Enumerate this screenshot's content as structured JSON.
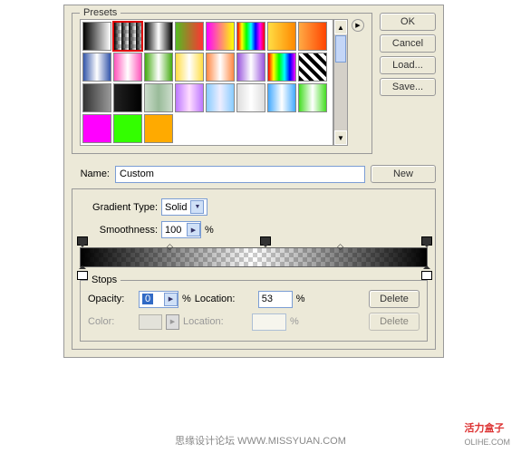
{
  "presets": {
    "label": "Presets"
  },
  "buttons": {
    "ok": "OK",
    "cancel": "Cancel",
    "load": "Load...",
    "save": "Save...",
    "new": "New",
    "delete": "Delete"
  },
  "name": {
    "label": "Name:",
    "value": "Custom"
  },
  "gradient_type": {
    "label": "Gradient Type:",
    "value": "Solid"
  },
  "smoothness": {
    "label": "Smoothness:",
    "value": "100",
    "unit": "%"
  },
  "stops": {
    "label": "Stops",
    "opacity": {
      "label": "Opacity:",
      "value": "0",
      "unit": "%"
    },
    "location1": {
      "label": "Location:",
      "value": "53",
      "unit": "%"
    },
    "color": {
      "label": "Color:"
    },
    "location2": {
      "label": "Location:",
      "value": "",
      "unit": "%"
    }
  },
  "footer": {
    "center": "思缘设计论坛  WWW.MISSYUAN.COM",
    "right_cn": "活力盒子",
    "right_url": "OLIHE.COM"
  },
  "chart_data": {
    "type": "table",
    "description": "Photoshop Gradient Editor state",
    "opacity_stops": [
      {
        "location_pct": 0,
        "opacity_pct": 100
      },
      {
        "location_pct": 53,
        "opacity_pct": 0
      },
      {
        "location_pct": 100,
        "opacity_pct": 100
      }
    ],
    "color_stops": [
      {
        "location_pct": 0,
        "color": "#000000"
      },
      {
        "location_pct": 100,
        "color": "#000000"
      }
    ],
    "selected_opacity_stop": {
      "location_pct": 53,
      "opacity_pct": 0
    },
    "gradient_type": "Solid",
    "smoothness_pct": 100,
    "selected_preset_index": 1
  }
}
